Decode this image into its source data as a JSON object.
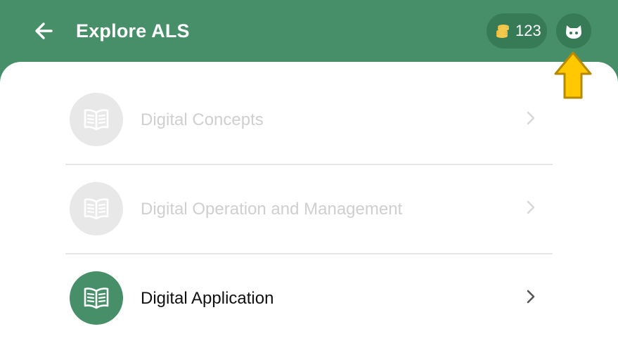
{
  "header": {
    "title": "Explore ALS",
    "coins": "123",
    "back_icon": "arrow-left-icon",
    "coins_icon": "coins-stack-icon",
    "avatar_icon": "cat-face-icon"
  },
  "colors": {
    "brand_green": "#478f69",
    "pill_green": "#377a56",
    "disabled_circle": "#e8e8e8",
    "disabled_text": "#cfcfcf",
    "coin_gold": "#f2c94c",
    "hint_arrow": "#ffc800"
  },
  "topics": [
    {
      "label": "Digital Concepts",
      "state": "disabled",
      "icon": "open-book-icon"
    },
    {
      "label": "Digital Operation and Management",
      "state": "disabled",
      "icon": "open-book-icon"
    },
    {
      "label": "Digital Application",
      "state": "active",
      "icon": "open-book-icon"
    }
  ],
  "overlay": {
    "hint_arrow_icon": "up-arrow-icon"
  }
}
